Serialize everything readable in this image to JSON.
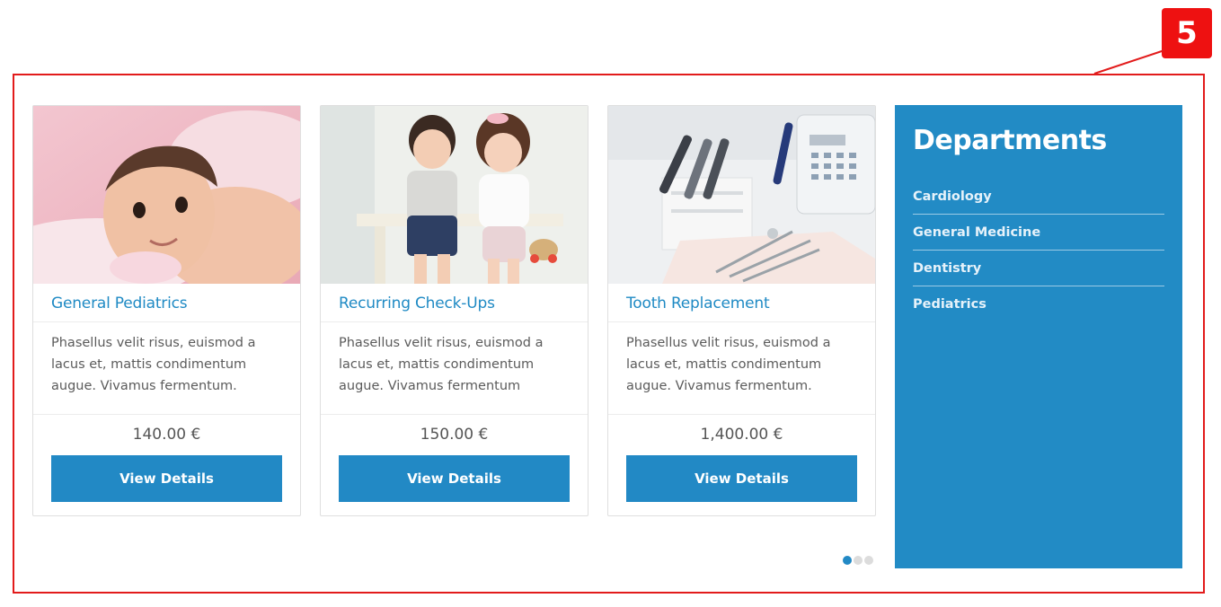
{
  "annotation": {
    "badge": "5",
    "color": "#e21b1b"
  },
  "cards": [
    {
      "title": "General Pediatrics",
      "description": "Phasellus velit risus, euismod a lacus et, mattis condimentum augue. Vivamus fermentum.",
      "price": "140.00 €",
      "button": "View Details",
      "image": "baby-photo"
    },
    {
      "title": "Recurring Check-Ups",
      "description": "Phasellus velit risus, euismod a lacus et, mattis condimentum augue. Vivamus fermentum",
      "price": "150.00 €",
      "button": "View Details",
      "image": "children-photo"
    },
    {
      "title": "Tooth Replacement",
      "description": "Phasellus velit risus, euismod a lacus et, mattis condimentum augue. Vivamus fermentum.",
      "price": "1,400.00 €",
      "button": "View Details",
      "image": "dental-equipment-photo"
    }
  ],
  "departments": {
    "title": "Departments",
    "items": [
      "Cardiology",
      "General Medicine",
      "Dentistry",
      "Pediatrics"
    ]
  },
  "carousel": {
    "pages": 3,
    "active": 1
  },
  "colors": {
    "accent": "#2289c5",
    "panel": "#228bc5",
    "title": "#1f8ac4"
  }
}
